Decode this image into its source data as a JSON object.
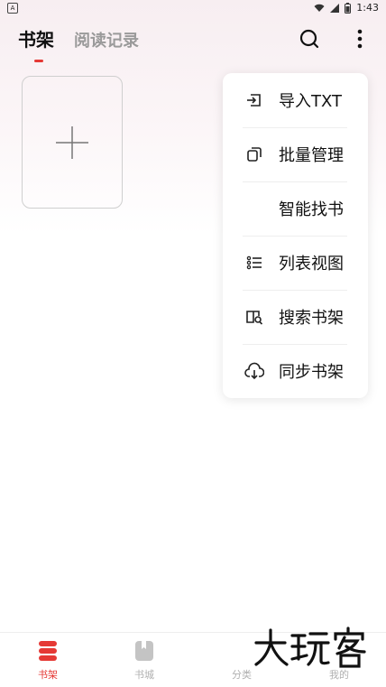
{
  "status_bar": {
    "time": "1:43",
    "app_glyph": "A"
  },
  "header": {
    "tabs": [
      {
        "label": "书架",
        "active": true
      },
      {
        "label": "阅读记录",
        "active": false
      }
    ],
    "icons": [
      "search-icon",
      "more-vertical-icon"
    ]
  },
  "shelf": {
    "add_card_icon": "plus-icon"
  },
  "menu": {
    "items": [
      {
        "label": "导入TXT",
        "icon": "import-icon"
      },
      {
        "label": "批量管理",
        "icon": "copy-icon"
      },
      {
        "label": "智能找书",
        "icon": ""
      },
      {
        "label": "列表视图",
        "icon": "list-view-icon"
      },
      {
        "label": "搜索书架",
        "icon": "book-search-icon"
      },
      {
        "label": "同步书架",
        "icon": "cloud-download-icon"
      }
    ]
  },
  "bottom_nav": {
    "items": [
      {
        "label": "书架",
        "active": true
      },
      {
        "label": "书城",
        "active": false
      },
      {
        "label": "分类",
        "active": false
      },
      {
        "label": "我的",
        "active": false
      }
    ]
  },
  "colors": {
    "accent": "#e53935",
    "inactive": "#b0b0b0"
  }
}
